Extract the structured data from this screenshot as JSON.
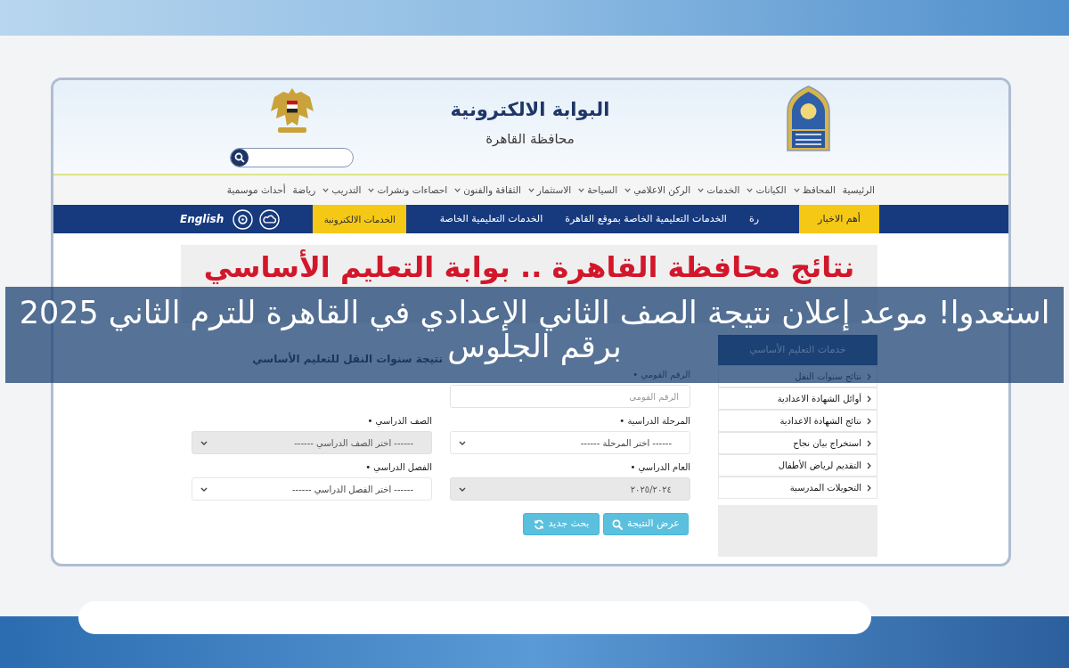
{
  "header": {
    "title": "البوابة الالكترونية",
    "subtitle": "محافظة القاهرة"
  },
  "nav_menu": [
    {
      "label": "الرئيسية",
      "dropdown": false
    },
    {
      "label": "المحافظ",
      "dropdown": true
    },
    {
      "label": "الكيانات",
      "dropdown": true
    },
    {
      "label": "الخدمات",
      "dropdown": true
    },
    {
      "label": "الركن الاعلامي",
      "dropdown": true
    },
    {
      "label": "السياحة",
      "dropdown": true
    },
    {
      "label": "الاستثمار",
      "dropdown": true
    },
    {
      "label": "الثقافة والفنون",
      "dropdown": true
    },
    {
      "label": "احصاءات ونشرات",
      "dropdown": true
    },
    {
      "label": "التدريب",
      "dropdown": true
    },
    {
      "label": "رياضة",
      "dropdown": false
    },
    {
      "label": "أحداث موسمية",
      "dropdown": false
    }
  ],
  "news_bar": {
    "label": "أهم الاخبار",
    "ticker": [
      "رة",
      "الخدمات التعليمية الخاصة بموقع القاهرة",
      "الخدمات التعليمية الخاصة"
    ],
    "services_tab": "الخدمات الالكترونية",
    "language_link": "English"
  },
  "banner": {
    "title": "نتائج محافظة القاهرة .. بوابة التعليم الأساسي"
  },
  "headline": {
    "lines": [
      "استعدوا! موعد إعلان نتيجة الصف الثاني الإعدادي في القاهرة للترم الثاني 2025",
      "برقم الجلوس"
    ]
  },
  "sidebar": {
    "title": "خدمات التعليم الأساسي",
    "items": [
      "نتائج سنوات النقل",
      "أوائل الشهادة الاعدادية",
      "نتائج الشهادة الاعدادية",
      "استخراج بيان نجاح",
      "التقديم لرياض الأطفال",
      "التحويلات المدرسية"
    ]
  },
  "form": {
    "title": "نتيجة سنوات النقل للتعليم الأساسي",
    "rows": [
      [
        {
          "kind": "input",
          "label": "الرقم القومي •",
          "placeholder": "الرقم القومي",
          "disabled": false
        }
      ],
      [
        {
          "kind": "select",
          "label": "المرحلة الدراسية •",
          "value": "------ اختر المرحلة ------",
          "disabled": false
        },
        {
          "kind": "select",
          "label": "الصف الدراسي •",
          "value": "------ اختر الصف الدراسي ------",
          "disabled": true
        }
      ],
      [
        {
          "kind": "select",
          "label": "العام الدراسي •",
          "value": "٢٠٢٥/٢٠٢٤",
          "disabled": true
        },
        {
          "kind": "select",
          "label": "الفصل الدراسي •",
          "value": "------ اختر الفصل الدراسي ------",
          "disabled": false
        }
      ]
    ],
    "buttons": [
      {
        "kind": "submit",
        "label": "عرض النتيجة"
      },
      {
        "kind": "reset",
        "label": "بحث جديد"
      }
    ]
  }
}
